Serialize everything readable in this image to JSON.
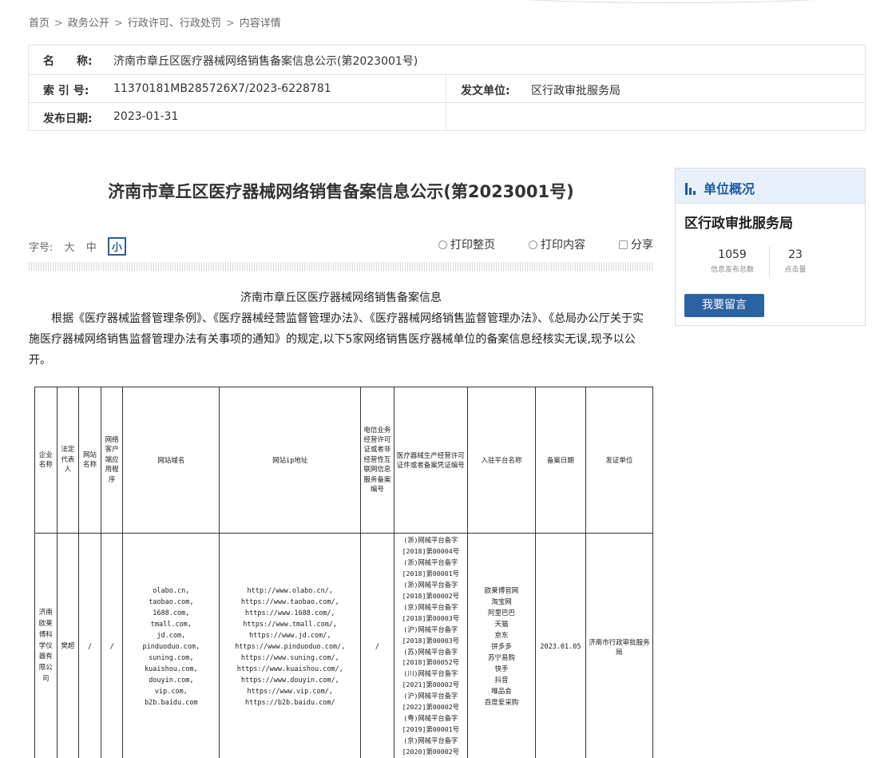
{
  "breadcrumb": [
    {
      "label": "首页"
    },
    {
      "label": "政务公开"
    },
    {
      "label": "行政许可、行政处罚"
    },
    {
      "label": "内容详情"
    }
  ],
  "breadcrumb_sep": ">",
  "meta": {
    "name_key": "名　　称:",
    "name_value": "济南市章丘区医疗器械网络销售备案信息公示(第2023001号)",
    "index_key": "索 引 号:",
    "index_value": "11370181MB285726X7/2023-6228781",
    "issuer_key": "发文单位:",
    "issuer_value": "区行政审批服务局",
    "date_key": "发布日期:",
    "date_value": "2023-01-31"
  },
  "article": {
    "title": "济南市章丘区医疗器械网络销售备案信息公示(第2023001号)",
    "fontsize_label": "字号:",
    "fontsize_options": [
      "大",
      "中",
      "小"
    ],
    "print_page": "打印整页",
    "print_content": "打印内容",
    "share": "分享",
    "heading": "济南市章丘区医疗器械网络销售备案信息",
    "paragraph": "根据《医疗器械监督管理条例》、《医疗器械经营监督管理办法》、《医疗器械网络销售监督管理办法》、《总局办公厅关于实施医疗器械网络销售监督管理办法有关事项的通知》的规定,以下5家网络销售医疗器械单位的备案信息经核实无误,现予以公开。"
  },
  "table": {
    "headers": [
      "企业名称",
      "法定代表人",
      "网站名称",
      "网络客户端应用程序",
      "网站域名",
      "网站ip地址",
      "电信业务经营许可证或者非经营性互联网信息服务备案编号",
      "医疗器械生产经营许可证件或者备案凭证编号",
      "入驻平台名称",
      "备案日期",
      "发证单位"
    ],
    "rows": [
      {
        "company": "济南欧莱博科学仪器有限公司",
        "legal_rep": "樊超",
        "site_name": "/",
        "app": "/",
        "domains": [
          "olabo.cn,",
          "taobao.com,",
          "1688.com,",
          "tmall.com,",
          "jd.com,",
          "pinduoduo.com,",
          "suning.com,",
          "kuaishou.com,",
          "douyin.com,",
          "vip.com,",
          "b2b.baidu.com"
        ],
        "ips": [
          "http://www.olabo.cn/,",
          "https://www.taobao.com/,",
          "https://www.1688.com/,",
          "https://www.tmall.com/,",
          "https://www.jd.com/,",
          "https://www.pinduoduo.com/,",
          "https://www.suning.com/,",
          "https://www.kuaishou.com/,",
          "https://www.douyin.com/,",
          "https://www.vip.com/,",
          "https://b2b.baidu.com/"
        ],
        "telecom": "/",
        "licenses": [
          "(浙)网械平台备字",
          "[2018]第00004号",
          "(浙)网械平台备字",
          "[2018]第00001号",
          "(浙)网械平台备字",
          "[2018]第00002号",
          "(京)网械平台备字",
          "[2018]第00003号",
          "(沪)网械平台备字",
          "[2018]第00003号",
          "(苏)网械平台备字",
          "[2018]第00052号",
          "(川)网械平台备字",
          "[2021]第00002号",
          "(沪)网械平台备字",
          "[2022]第00002号",
          "(粤)网械平台备字",
          "[2019]第00001号",
          "(京)网械平台备字",
          "[2020]第00002号"
        ],
        "platforms": [
          "欧莱博官网",
          "淘宝网",
          "阿里巴巴",
          "天猫",
          "京东",
          "拼多多",
          "苏宁易购",
          "快手",
          "抖音",
          "唯品会",
          "百度爱采购"
        ],
        "date": "2023.01.05",
        "issuer": "济南市行政审批服务局"
      }
    ]
  },
  "sidebar": {
    "header": "单位概况",
    "org_name": "区行政审批服务局",
    "stats": [
      {
        "value": "1059",
        "label": "信息发布总数"
      },
      {
        "value": "23",
        "label": "点击量"
      }
    ],
    "message_button": "我要留言"
  },
  "colors": {
    "accent": "#2b62a4",
    "sidebar_header_bg": "#e8f1fb",
    "border": "#e3e3e3"
  }
}
